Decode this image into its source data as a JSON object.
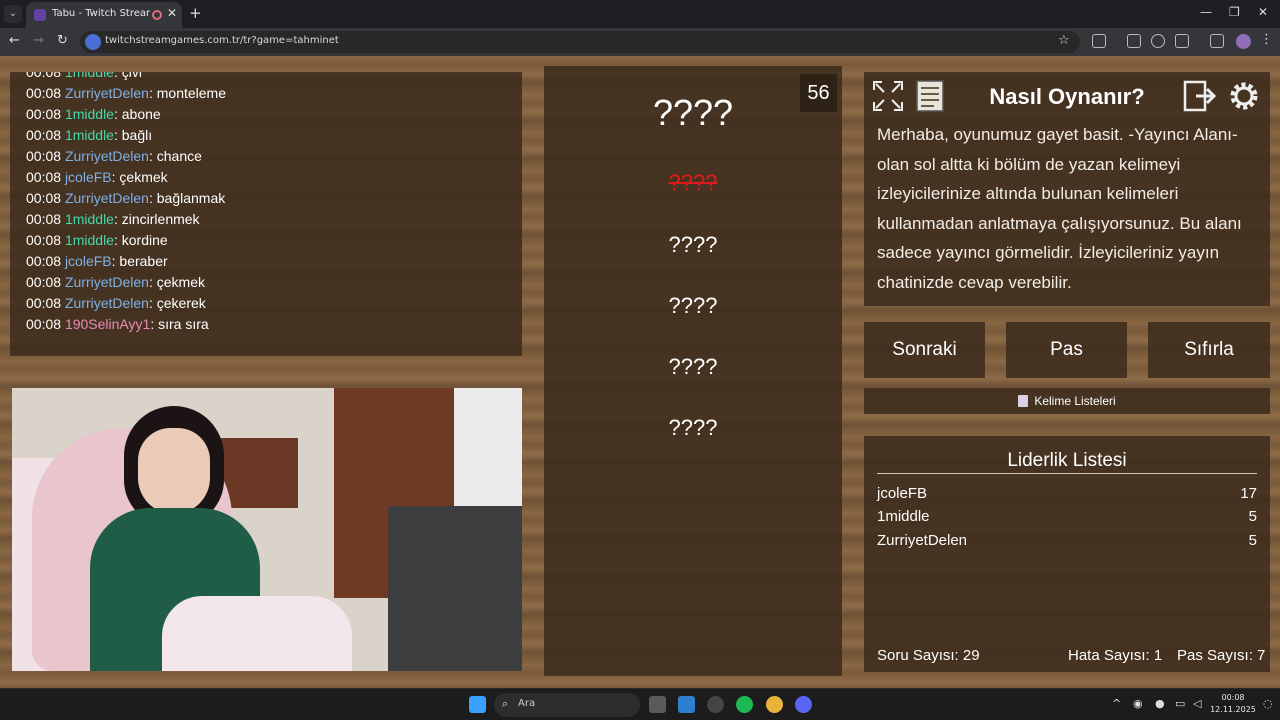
{
  "browser": {
    "tab_title": "Tabu - Twitch Stream Game",
    "url": "twitchstreamgames.com.tr/tr?game=tahminet"
  },
  "chat": [
    {
      "time": "00:08",
      "user": "1middle",
      "msg": "çivi",
      "color": "teal"
    },
    {
      "time": "00:08",
      "user": "ZurriyetDelen",
      "msg": "monteleme",
      "color": "blue"
    },
    {
      "time": "00:08",
      "user": "1middle",
      "msg": "abone",
      "color": "teal"
    },
    {
      "time": "00:08",
      "user": "1middle",
      "msg": "bağlı",
      "color": "teal"
    },
    {
      "time": "00:08",
      "user": "ZurriyetDelen",
      "msg": "chance",
      "color": "blue"
    },
    {
      "time": "00:08",
      "user": "jcoleFB",
      "msg": "çekmek",
      "color": "blue"
    },
    {
      "time": "00:08",
      "user": "ZurriyetDelen",
      "msg": "bağlanmak",
      "color": "blue"
    },
    {
      "time": "00:08",
      "user": "1middle",
      "msg": "zincirlenmek",
      "color": "teal"
    },
    {
      "time": "00:08",
      "user": "1middle",
      "msg": "kordine",
      "color": "teal"
    },
    {
      "time": "00:08",
      "user": "jcoleFB",
      "msg": "beraber",
      "color": "blue"
    },
    {
      "time": "00:08",
      "user": "ZurriyetDelen",
      "msg": "çekmek",
      "color": "blue"
    },
    {
      "time": "00:08",
      "user": "ZurriyetDelen",
      "msg": "çekerek",
      "color": "blue"
    },
    {
      "time": "00:08",
      "user": "190SelinAyy1",
      "msg": "sıra sıra",
      "color": "pink"
    }
  ],
  "game": {
    "timer": "56",
    "main_word": "????",
    "forbidden_words": [
      "????",
      "????",
      "????",
      "????",
      "????"
    ]
  },
  "howto": {
    "title": "Nasıl Oynanır?",
    "text": "Merhaba, oyunumuz gayet basit. -Yayıncı Alanı- olan sol altta ki bölüm de yazan kelimeyi izleyicilerinize altında bulunan kelimeleri kullanmadan anlatmaya çalışıyorsunuz. Bu alanı sadece yayıncı görmelidir. İzleyicileriniz yayın chatinizde cevap verebilir.",
    "icons": [
      "fullscreen-icon",
      "notes-icon",
      "exit-icon",
      "settings-icon"
    ]
  },
  "controls": {
    "next": "Sonraki",
    "pass": "Pas",
    "reset": "Sıfırla",
    "word_lists": "Kelime Listeleri"
  },
  "leaderboard": {
    "title": "Liderlik Listesi",
    "rows": [
      {
        "name": "jcoleFB",
        "score": "17"
      },
      {
        "name": "1middle",
        "score": "5"
      },
      {
        "name": "ZurriyetDelen",
        "score": "5"
      }
    ]
  },
  "stats": {
    "questions": "Soru Sayısı: 29",
    "errors": "Hata Sayısı: 1",
    "passes": "Pas Sayısı: 7"
  },
  "taskbar": {
    "search_label": "Ara",
    "time": "00:08",
    "date": "12.11.2025"
  },
  "colors": {
    "chat_teal": "#45d8a8",
    "chat_blue": "#7fb0e5",
    "chat_pink": "#e88bb4",
    "crossed_word": "#e01919"
  }
}
